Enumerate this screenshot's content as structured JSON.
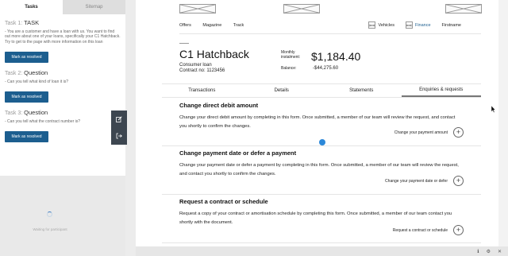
{
  "left_panel": {
    "tabs": [
      "Tasks",
      "Sitemap"
    ],
    "tasks": [
      {
        "label": "Task 1:",
        "title": "TASK",
        "text": "- You are a customer and have a loan with us. You want to find out more about one of your loans, specifically your C1 Hatchback. Try to get to the page with more information on this loan",
        "button": "Mark as resolved"
      },
      {
        "label": "Task 2:",
        "title": "Question",
        "text": "- Can you tell what kind of loan it is?",
        "button": "Mark as resolved"
      },
      {
        "label": "Task 3:",
        "title": "Question",
        "text": "- Can you tell what the contract number is?",
        "button": "Mark as resolved"
      }
    ],
    "waiting_text": "Waiting for participant"
  },
  "side_tools": {
    "edit_icon": "edit-icon",
    "exit_icon": "exit-icon"
  },
  "nav": {
    "links": [
      "Offers",
      "Magazine",
      "Track"
    ],
    "right": {
      "vehicles": "Vehicles",
      "finance": "Finance",
      "firstname": "Firstname"
    }
  },
  "account": {
    "title": "C1 Hatchback",
    "loan_type": "Consumer loan",
    "contract": "Contract no: 1123456",
    "monthly_label": "Monthly instalment:",
    "monthly_value": "$1,184.40",
    "balance_label": "Balance:",
    "balance_value": "-$44,275.60"
  },
  "account_tabs": [
    "Transactions",
    "Details",
    "Statements",
    "Enquiries & requests"
  ],
  "active_tab": "Enquiries & requests",
  "sections": [
    {
      "title": "Change direct debit amount",
      "body": "Change your direct debit amount by completing in this form. Once submitted, a member of our team will review the request, and contact you shortly to confirm the changes.",
      "action": "Change your payment amount"
    },
    {
      "title": "Change payment date or defer a payment",
      "body": "Change your payment date or defer a payment by completing in this form. Once submitted, a member of our team will review the request, and contact you shortly to confirm the changes.",
      "action": "Change your payment date or defer"
    },
    {
      "title": "Request a contract or schedule",
      "body": "Request a copy of your contract or amortisation schedule by completing this form. Once submitted, a member of our team contact you shortly with the document.",
      "action": "Request a contract or schedule"
    }
  ],
  "status_bar_icons": [
    "info-icon",
    "settings-icon",
    "close-icon"
  ],
  "colors": {
    "accent": "#1c5e8f",
    "dark_tool": "#3d4650",
    "dot": "#2c88d9"
  }
}
